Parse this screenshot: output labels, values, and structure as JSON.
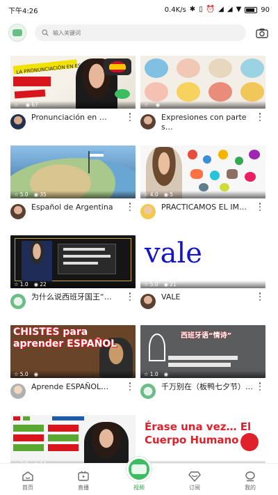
{
  "status": {
    "time": "下午4:26",
    "net_speed": "0.4K/s",
    "battery": "90"
  },
  "search": {
    "placeholder": "输入关键词"
  },
  "cards": [
    {
      "title": "Pronunciación en …",
      "rating": "",
      "views": "67",
      "thumb_text": "LA PRONUNCIACIÓN EN ESPAÑOL El alfabeto"
    },
    {
      "title": "Expresiones con partes…",
      "rating": "",
      "views": "",
      "thumb_text": ""
    },
    {
      "title": "Español de Argentina",
      "rating": "5.0",
      "views": "35",
      "thumb_text": ""
    },
    {
      "title": "PRACTICAMOS EL IM…",
      "rating": "4.0",
      "views": "5",
      "thumb_text": ""
    },
    {
      "title": "为什么说西班牙国王“…",
      "rating": "1.0",
      "views": "22",
      "thumb_text": ""
    },
    {
      "title": "VALE",
      "rating": "5.0",
      "views": "21",
      "thumb_text": "vale"
    },
    {
      "title": "Aprende ESPAÑOL…",
      "rating": "5.0",
      "views": "",
      "thumb_text": "CHISTES para aprender ESPAÑOL"
    },
    {
      "title": "千万别在（板鸭七夕节）…",
      "rating": "1.0",
      "views": "",
      "thumb_text": "西班牙语“情诗”"
    },
    {
      "title": "",
      "rating": "2.0",
      "views": "14",
      "thumb_text": ""
    },
    {
      "title": "",
      "rating": "",
      "views": "",
      "thumb_text": "Érase una vez… El Cuerpo Humano"
    }
  ],
  "nav": [
    {
      "label": "首页",
      "icon": "home-icon",
      "active": false
    },
    {
      "label": "直播",
      "icon": "tv-icon",
      "active": false
    },
    {
      "label": "视频",
      "icon": "video-icon",
      "active": true
    },
    {
      "label": "订阅",
      "icon": "diamond-icon",
      "active": false
    },
    {
      "label": "我的",
      "icon": "profile-icon",
      "active": false
    }
  ],
  "colors": {
    "accent": "#3dbd62",
    "nav_active": "#2fa84f"
  }
}
